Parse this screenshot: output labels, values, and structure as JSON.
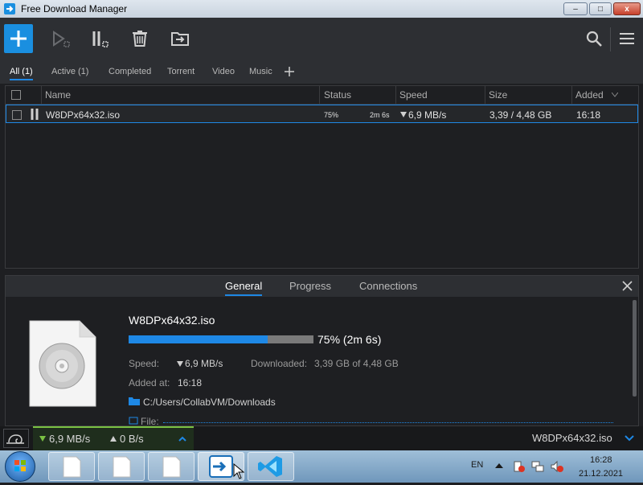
{
  "window": {
    "title": "Free Download Manager",
    "minimize_label": "–",
    "maximize_label": "□",
    "close_label": "x"
  },
  "tabs": [
    {
      "label": "All (1)",
      "active": true
    },
    {
      "label": "Active (1)"
    },
    {
      "label": "Completed"
    },
    {
      "label": "Torrent"
    },
    {
      "label": "Video"
    },
    {
      "label": "Music"
    }
  ],
  "columns": {
    "name": "Name",
    "status": "Status",
    "speed": "Speed",
    "size": "Size",
    "added": "Added"
  },
  "download": {
    "name": "W8DPx64x32.iso",
    "progress_text": "75%",
    "progress_fraction": 0.75,
    "time_left": "2m 6s",
    "speed": "6,9 MB/s",
    "size": "3,39 / 4,48 GB",
    "added": "16:18"
  },
  "details": {
    "tabs": [
      "General",
      "Progress",
      "Connections"
    ],
    "filename": "W8DPx64x32.iso",
    "progress_label": "75% (2m 6s)",
    "speed_label": "Speed:",
    "speed_value": "6,9 MB/s",
    "downloaded_label": "Downloaded:",
    "downloaded_value": "3,39 GB of 4,48 GB",
    "added_label": "Added at:",
    "added_value": "16:18",
    "path": "C:/Users/CollabVM/Downloads",
    "file_label": "File:"
  },
  "statusbar": {
    "down_speed": "6,9 MB/s",
    "up_speed": "0 B/s",
    "current_file": "W8DPx64x32.iso"
  },
  "taskbar": {
    "lang": "EN",
    "time": "16:28",
    "date": "21.12.2021"
  },
  "colors": {
    "accent": "#1e88e5",
    "add_button": "#1a8fe0",
    "progress_bg": "#7a7a7a",
    "green": "#7ac143"
  }
}
